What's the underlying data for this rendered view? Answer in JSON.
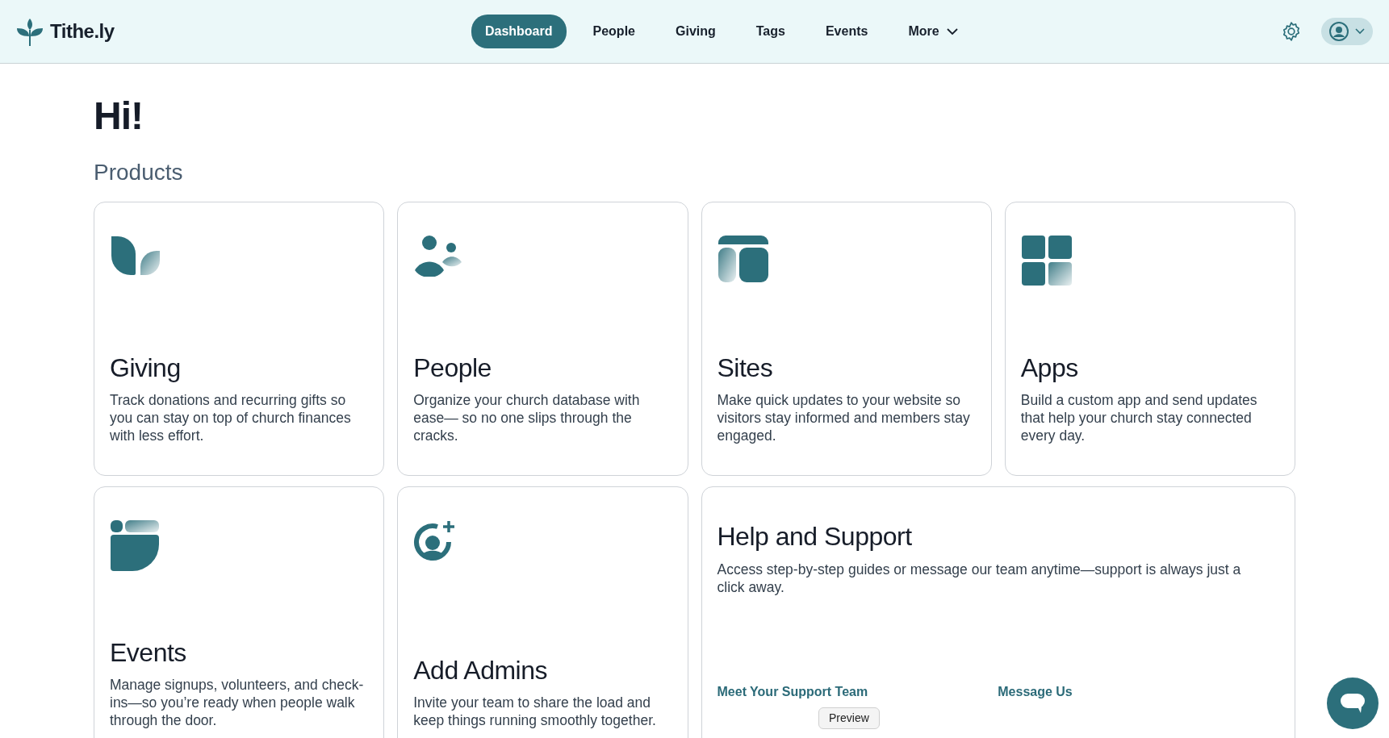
{
  "brand": {
    "name": "Tithe.ly"
  },
  "nav": [
    {
      "label": "Dashboard",
      "selected": true,
      "has_menu": false
    },
    {
      "label": "People",
      "selected": false,
      "has_menu": false
    },
    {
      "label": "Giving",
      "selected": false,
      "has_menu": false
    },
    {
      "label": "Tags",
      "selected": false,
      "has_menu": false
    },
    {
      "label": "Events",
      "selected": false,
      "has_menu": false
    },
    {
      "label": "More",
      "selected": false,
      "has_menu": true
    }
  ],
  "greeting": "Hi!",
  "section_title": "Products",
  "cards": [
    {
      "kind": "product",
      "title": "Giving",
      "description": "Track donations and recurring gifts so you can stay on top of church finances with less effort."
    },
    {
      "kind": "product",
      "title": "People",
      "description": "Organize your church database with ease— so no one slips through the cracks."
    },
    {
      "kind": "product",
      "title": "Sites",
      "description": "Make quick updates to your website so visitors stay informed and members stay engaged."
    },
    {
      "kind": "product",
      "title": "Apps",
      "description": "Build a custom app and send updates that help your church stay connected every day."
    },
    {
      "kind": "product",
      "title": "Events",
      "description": "Manage signups, volunteers, and check-ins—so you’re ready when people walk through the door."
    },
    {
      "kind": "product",
      "title": "Add Admins",
      "description": "Invite your team to share the load and keep things running smoothly together."
    },
    {
      "kind": "support",
      "title": "Help and Support",
      "description": "Access step-by-step guides or message our team anytime—support is always just a click away.",
      "links": [
        "Meet Your Support Team",
        "Message Us"
      ]
    }
  ],
  "tooltip": "Preview"
}
